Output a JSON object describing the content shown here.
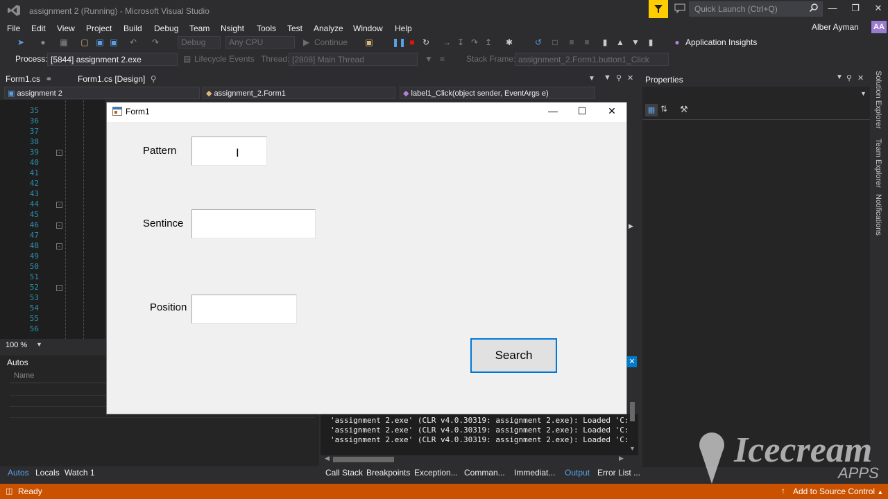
{
  "window": {
    "title": "assignment 2 (Running) - Microsoft Visual Studio"
  },
  "quick_launch": {
    "placeholder": "Quick Launch (Ctrl+Q)"
  },
  "menu": [
    "File",
    "Edit",
    "View",
    "Project",
    "Build",
    "Debug",
    "Team",
    "Nsight",
    "Tools",
    "Test",
    "Analyze",
    "Window",
    "Help"
  ],
  "user": {
    "name": "Alber Ayman",
    "initials": "AA"
  },
  "toolbar": {
    "config": "Debug",
    "platform": "Any CPU",
    "continue": "Continue",
    "app_insights": "Application Insights"
  },
  "debug_bar": {
    "process_label": "Process:",
    "process": "[5844] assignment 2.exe",
    "lifecycle": "Lifecycle Events",
    "thread_label": "Thread:",
    "thread": "[2808] Main Thread",
    "stack_label": "Stack Frame:",
    "stack": "assignment_2.Form1.button1_Click"
  },
  "doc_tabs": [
    "Form1.cs",
    "Form1.cs [Design]"
  ],
  "nav": {
    "project": "assignment 2",
    "class": "assignment_2.Form1",
    "member": "label1_Click(object sender, EventArgs e)"
  },
  "editor": {
    "line_numbers": [
      "35",
      "36",
      "37",
      "38",
      "39",
      "40",
      "41",
      "42",
      "43",
      "44",
      "45",
      "46",
      "47",
      "48",
      "49",
      "50",
      "51",
      "52",
      "53",
      "54",
      "55",
      "56"
    ],
    "zoom": "100 %"
  },
  "autos": {
    "title": "Autos",
    "column": "Name"
  },
  "output_lines": [
    "'assignment 2.exe' (CLR v4.0.30319: assignment 2.exe): Loaded 'C:",
    "'assignment 2.exe' (CLR v4.0.30319: assignment 2.exe): Loaded 'C:",
    "'assignment 2.exe' (CLR v4.0.30319: assignment 2.exe): Loaded 'C:"
  ],
  "bottom_tabs_left": [
    "Autos",
    "Locals",
    "Watch 1"
  ],
  "bottom_tabs_right": [
    "Call Stack",
    "Breakpoints",
    "Exception...",
    "Comman...",
    "Immediat...",
    "Output",
    "Error List ..."
  ],
  "properties": {
    "title": "Properties"
  },
  "side_tabs": [
    "Solution Explorer",
    "Team Explorer",
    "Notifications"
  ],
  "form": {
    "title": "Form1",
    "pattern_label": "Pattern",
    "sentence_label": "Sentince",
    "position_label": "Position",
    "pattern_value": "",
    "sentence_value": "",
    "position_value": "",
    "search_label": "Search"
  },
  "status": {
    "text": "Ready",
    "source_control": "Add to Source Control"
  },
  "watermark": {
    "brand": "Icecream",
    "sub": "APPS"
  },
  "colors": {
    "status_bar": "#ca5100",
    "accent": "#0078d7",
    "filter": "#ffcc00"
  }
}
